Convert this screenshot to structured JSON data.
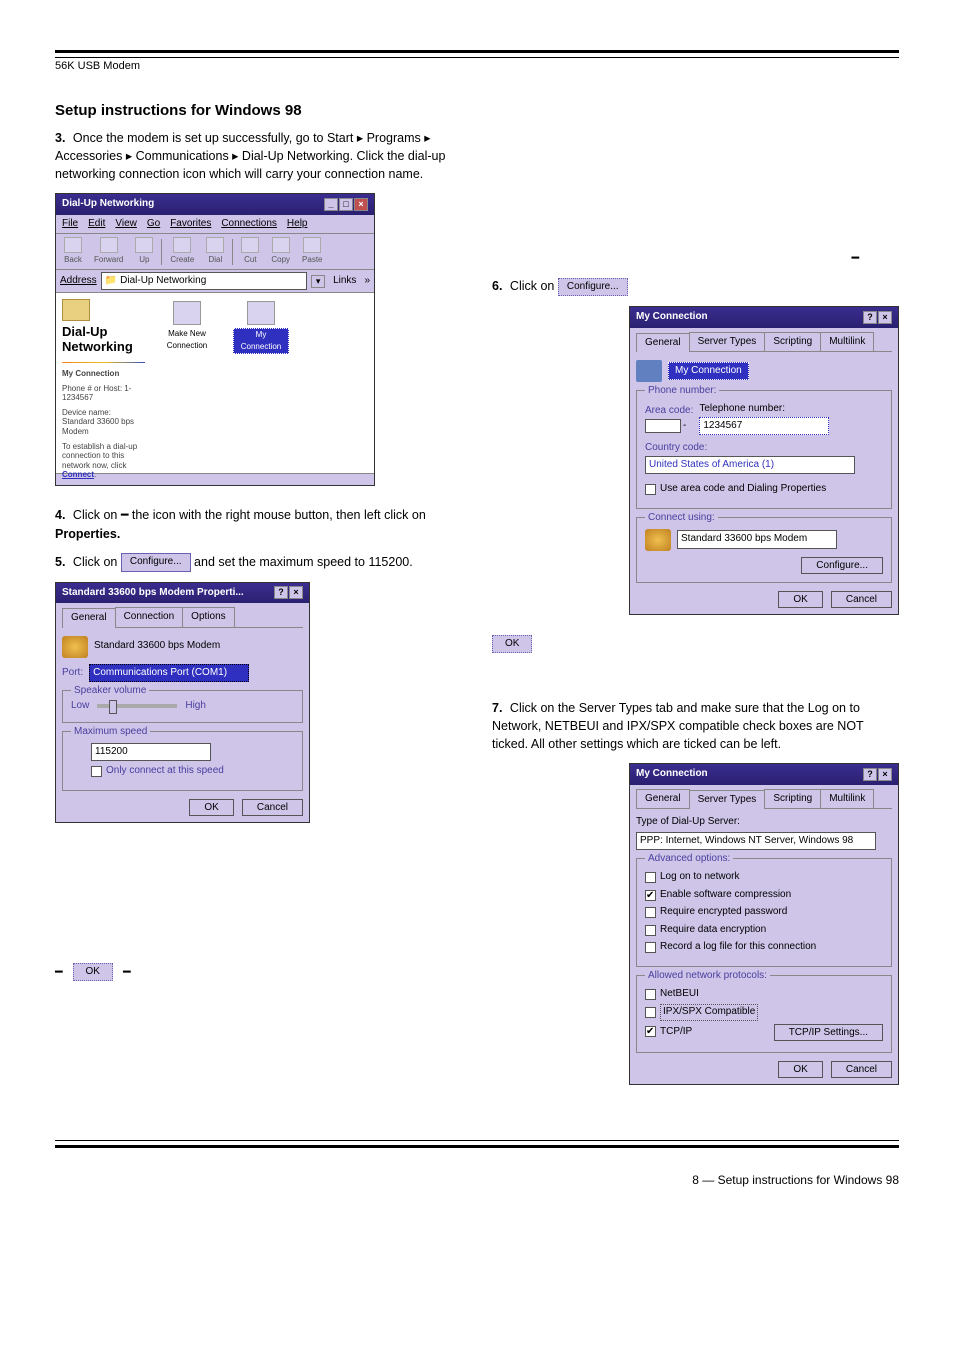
{
  "header": {
    "sub": "56K USB Modem"
  },
  "section_title": "Setup instructions for Windows 98",
  "leftcol": {
    "intro": "Once the modem is set up successfully, go to Start ▸ Programs ▸ Accessories ▸ Communications ▸ Dial-Up Networking. Click the dial-up networking connection icon which will carry your connection name.",
    "p2": "the icon with the right mouse button, then left click on",
    "p_properties": "Properties.",
    "step4": {
      "n": "4.",
      "text": "Click on "
    },
    "step5": {
      "n": "5.",
      "text": "Click on "
    },
    "ok_word": "OK",
    "configure_word": "Configure...",
    "set_max": " and set the maximum speed to 115200."
  },
  "rightcol": {
    "step6": {
      "n": "6.",
      "text": "Click on "
    },
    "step7": {
      "n": "7.",
      "text": "Click on the Server Types tab and make sure that the Log on to Network, NETBEUI and IPX/SPX compatible check boxes are NOT ticked. All other settings which are ticked can be left."
    }
  },
  "explorer": {
    "title": "Dial-Up Networking",
    "menu": [
      "File",
      "Edit",
      "View",
      "Go",
      "Favorites",
      "Connections",
      "Help"
    ],
    "tools": [
      {
        "label": "Back"
      },
      {
        "label": "Forward"
      },
      {
        "label": "Up"
      },
      {
        "label": "Create"
      },
      {
        "label": "Dial"
      },
      {
        "label": "Cut"
      },
      {
        "label": "Copy"
      },
      {
        "label": "Paste"
      }
    ],
    "address_label": "Address",
    "address_value": "Dial-Up Networking",
    "links_label": "Links",
    "side": {
      "big": "Dial-Up Networking",
      "conn_head": "My Connection",
      "phone": "Phone # or Host:\n1-1234567",
      "device": "Device name:\nStandard 33600 bps Modem",
      "help_text": "To establish a dial-up connection to this network now, click",
      "connect": "Connect"
    },
    "icons": [
      {
        "label": "Make New Connection"
      },
      {
        "label": "My Connection",
        "selected": true
      }
    ]
  },
  "modem_dlg": {
    "title": "Standard 33600 bps Modem Properti...",
    "tabs": [
      "General",
      "Connection",
      "Options"
    ],
    "modem_name": "Standard 33600 bps Modem",
    "port_label": "Port:",
    "port_value": "Communications Port (COM1)",
    "speaker_title": "Speaker volume",
    "low": "Low",
    "high": "High",
    "maxspeed_title": "Maximum speed",
    "speed_value": "115200",
    "only_connect": "Only connect at this speed",
    "ok": "OK",
    "cancel": "Cancel"
  },
  "configure_btn_label": "Configure...",
  "conn_dlg": {
    "title": "My Connection",
    "tabs": [
      "General",
      "Server Types",
      "Scripting",
      "Multilink"
    ],
    "name": "My Connection",
    "phone_group": "Phone number:",
    "area_label": "Area code:",
    "tel_label": "Telephone number:",
    "tel_value": "1234567",
    "country_label": "Country code:",
    "country_value": "United States of America (1)",
    "use_area": "Use area code and Dialing Properties",
    "connect_group": "Connect using:",
    "modem": "Standard 33600 bps Modem",
    "configure": "Configure...",
    "ok": "OK",
    "cancel": "Cancel"
  },
  "server_dlg": {
    "title": "My Connection",
    "tabs": [
      "General",
      "Server Types",
      "Scripting",
      "Multilink"
    ],
    "type_label": "Type of Dial-Up Server:",
    "type_value": "PPP: Internet, Windows NT Server, Windows 98",
    "adv_group": "Advanced options:",
    "adv": [
      {
        "label": "Log on to network",
        "checked": false
      },
      {
        "label": "Enable software compression",
        "checked": true
      },
      {
        "label": "Require encrypted password",
        "checked": false
      },
      {
        "label": "Require data encryption",
        "checked": false
      },
      {
        "label": "Record a log file for this connection",
        "checked": false
      }
    ],
    "proto_group": "Allowed network protocols:",
    "netbeui": "NetBEUI",
    "ipx": "IPX/SPX Compatible",
    "tcpip": "TCP/IP",
    "tcpip_btn": "TCP/IP Settings...",
    "ok": "OK",
    "cancel": "Cancel"
  },
  "page_num": "8 — Setup instructions for Windows 98"
}
